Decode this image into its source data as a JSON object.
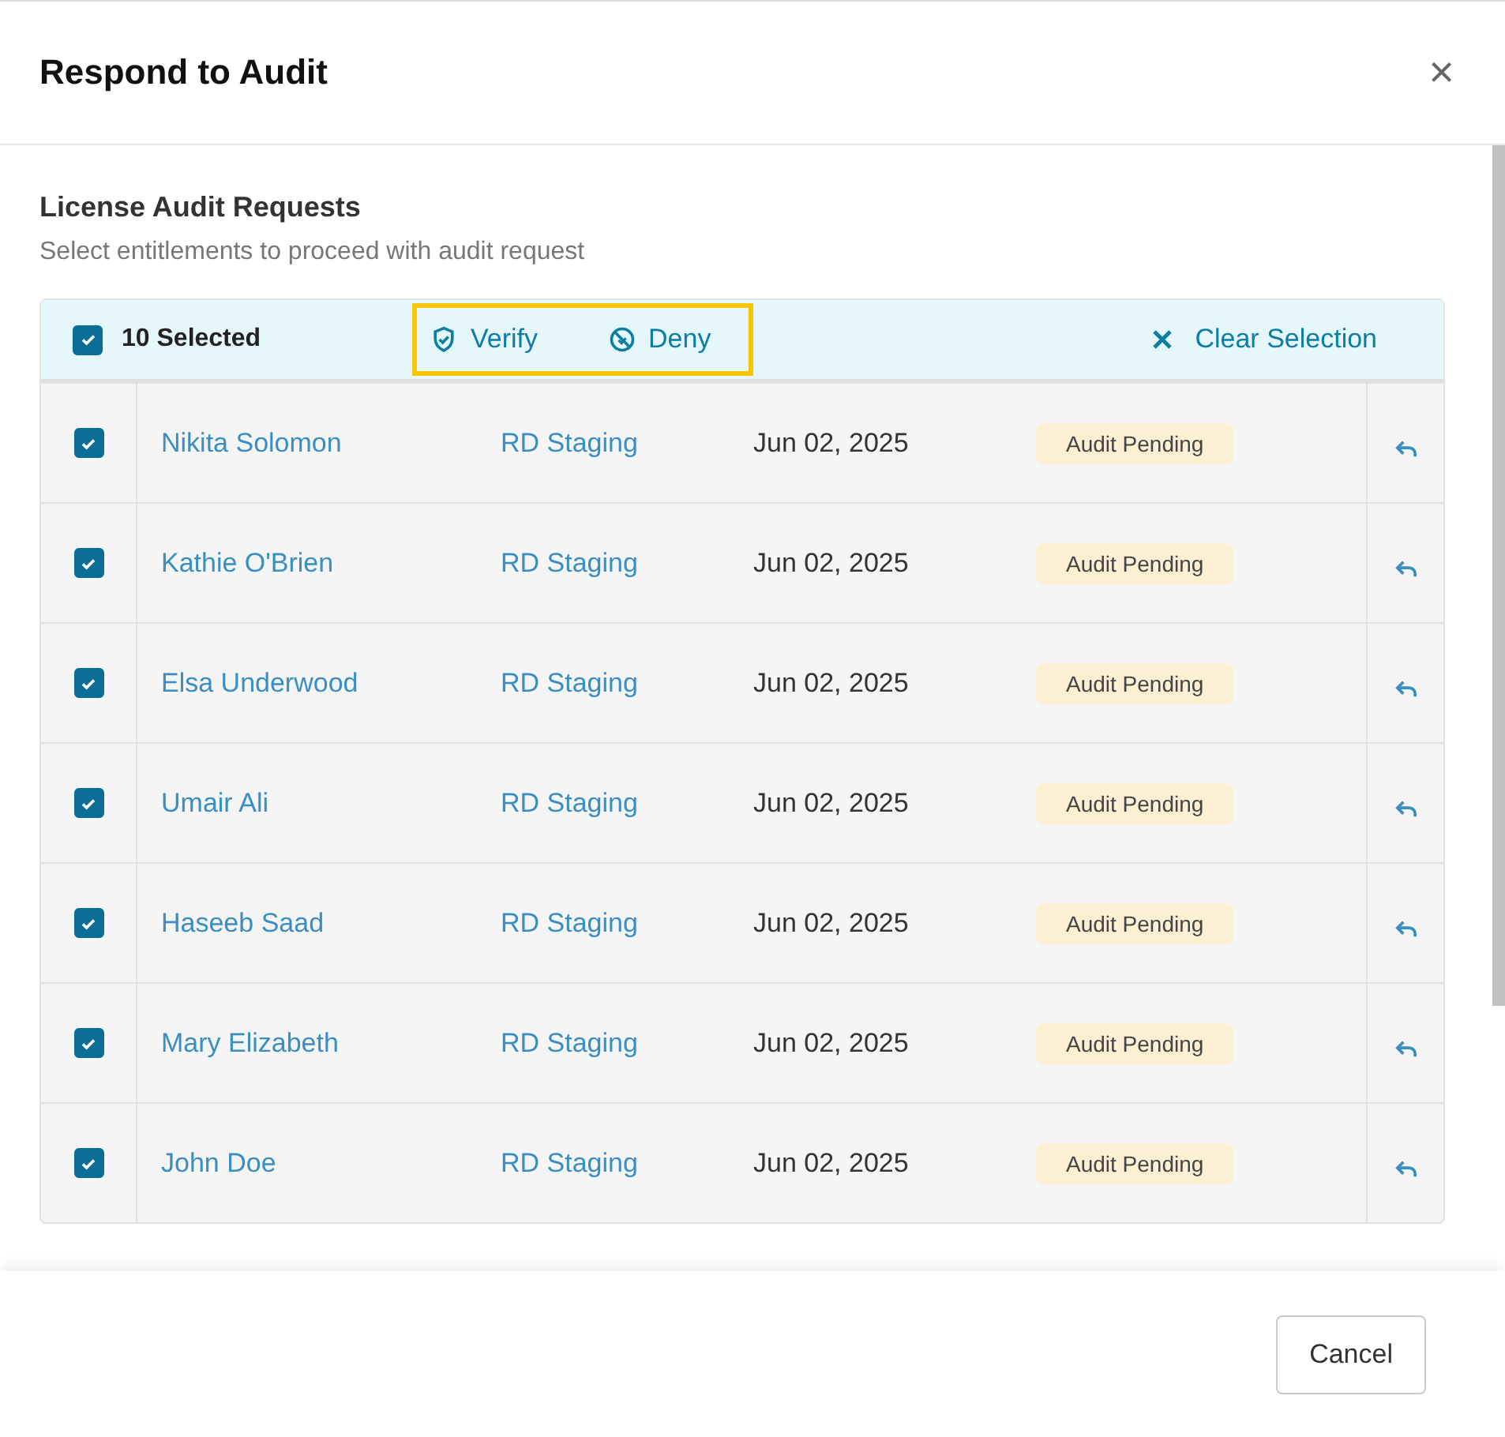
{
  "dialog": {
    "title": "Respond to Audit",
    "close_label": "×"
  },
  "section": {
    "title": "License Audit Requests",
    "subtitle": "Select entitlements to proceed with audit request"
  },
  "selection_bar": {
    "all_checked": true,
    "count_label": "10 Selected",
    "actions": [
      {
        "kind": "verify",
        "label": "Verify"
      },
      {
        "kind": "deny",
        "label": "Deny"
      }
    ],
    "clear_label": "Clear Selection"
  },
  "rows": [
    {
      "name": "Nikita Solomon",
      "environment": "RD Staging",
      "date": "Jun 02, 2025",
      "status": "Audit Pending",
      "checked": true
    },
    {
      "name": "Kathie O'Brien",
      "environment": "RD Staging",
      "date": "Jun 02, 2025",
      "status": "Audit Pending",
      "checked": true
    },
    {
      "name": "Elsa Underwood",
      "environment": "RD Staging",
      "date": "Jun 02, 2025",
      "status": "Audit Pending",
      "checked": true
    },
    {
      "name": "Umair Ali",
      "environment": "RD Staging",
      "date": "Jun 02, 2025",
      "status": "Audit Pending",
      "checked": true
    },
    {
      "name": "Haseeb Saad",
      "environment": "RD Staging",
      "date": "Jun 02, 2025",
      "status": "Audit Pending",
      "checked": true
    },
    {
      "name": "Mary Elizabeth",
      "environment": "RD Staging",
      "date": "Jun 02, 2025",
      "status": "Audit Pending",
      "checked": true
    },
    {
      "name": "John Doe",
      "environment": "RD Staging",
      "date": "Jun 02, 2025",
      "status": "Audit Pending",
      "checked": true
    }
  ],
  "footer": {
    "buttons": [
      "Cancel"
    ]
  }
}
